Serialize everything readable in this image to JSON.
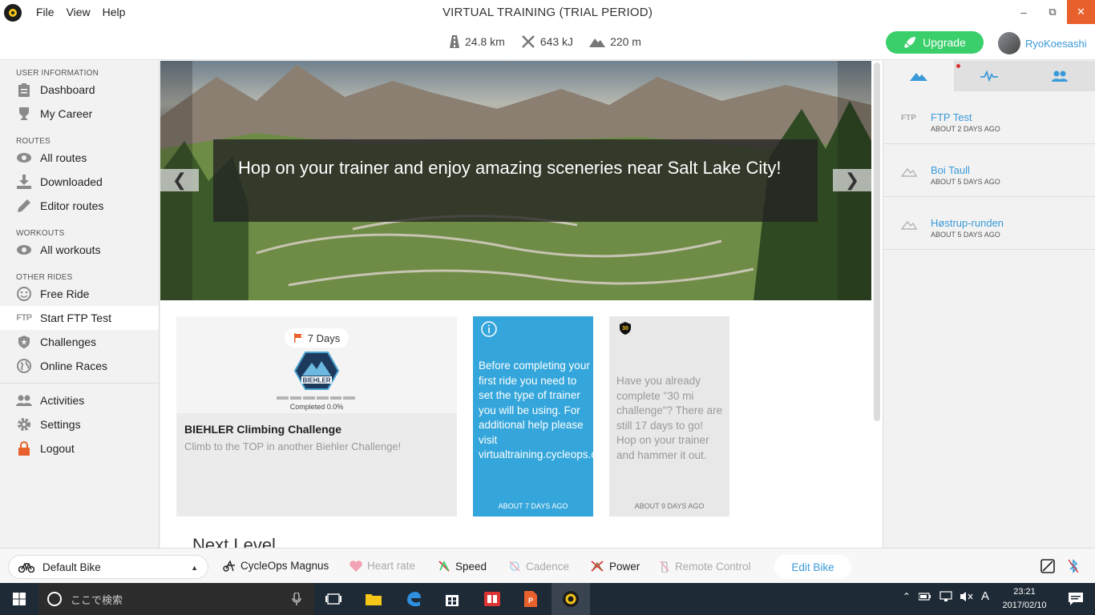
{
  "window": {
    "title": "VIRTUAL TRAINING (TRIAL PERIOD)",
    "menu": [
      "File",
      "View",
      "Help"
    ],
    "minimize": "–",
    "maximize": "⧉",
    "close": "✕"
  },
  "stats": {
    "distance": "24.8 km",
    "energy": "643 kJ",
    "elevation": "220 m"
  },
  "header": {
    "upgrade_label": "Upgrade",
    "username": "RyoKoesashi"
  },
  "sidebar": {
    "sections": [
      {
        "title": "USER INFORMATION",
        "items": [
          {
            "label": "Dashboard",
            "icon": "clipboard-icon"
          },
          {
            "label": "My Career",
            "icon": "trophy-icon"
          }
        ]
      },
      {
        "title": "ROUTES",
        "items": [
          {
            "label": "All routes",
            "icon": "eye-icon"
          },
          {
            "label": "Downloaded",
            "icon": "download-icon"
          },
          {
            "label": "Editor routes",
            "icon": "pencil-icon"
          }
        ]
      },
      {
        "title": "WORKOUTS",
        "items": [
          {
            "label": "All workouts",
            "icon": "eye-icon"
          }
        ]
      },
      {
        "title": "OTHER RIDES",
        "items": [
          {
            "label": "Free Ride",
            "icon": "smiley-icon"
          },
          {
            "label": "Start FTP Test",
            "icon": "ftp-icon"
          },
          {
            "label": "Challenges",
            "icon": "shield-icon"
          },
          {
            "label": "Online Races",
            "icon": "globe-icon"
          }
        ]
      }
    ],
    "bottom_items": [
      {
        "label": "Activities",
        "icon": "people-icon"
      },
      {
        "label": "Settings",
        "icon": "gear-icon"
      },
      {
        "label": "Logout",
        "icon": "lock-icon"
      }
    ],
    "ftp_icon_text": "FTP"
  },
  "hero": {
    "caption": "Hop on your trainer and enjoy amazing sceneries near Salt Lake City!",
    "prev": "❮",
    "next": "❯"
  },
  "challenge_card": {
    "days": "7 Days",
    "progress_text": "Completed 0.0%",
    "progress_fraction": 0.0,
    "title": "BIEHLER Climbing Challenge",
    "subtitle": "Climb to the TOP in another Biehler Challenge!",
    "logo_text": "BIEHLER"
  },
  "info_card": {
    "text": "Before completing your first ride you need to set the type of trainer you will be using. For additional help please visit virtualtraining.cycleops.com.",
    "time": "ABOUT 7 DAYS AGO"
  },
  "chal_card": {
    "icon_text": "30",
    "text": "Have you already complete \"30 mi challenge\"? There are still 17 days to go! Hop on your trainer and hammer it out.",
    "time": "ABOUT 9 DAYS AGO"
  },
  "next_level": "Next Level",
  "activities": [
    {
      "name": "FTP Test",
      "time": "ABOUT 2 DAYS AGO",
      "icon": "FTP"
    },
    {
      "name": "Boi Taull",
      "time": "ABOUT 5 DAYS AGO",
      "icon": "mountain"
    },
    {
      "name": "Høstrup-runden",
      "time": "ABOUT 5 DAYS AGO",
      "icon": "mountain"
    }
  ],
  "bottombar": {
    "bike": "Default Bike",
    "trainer": "CycleOps Magnus",
    "heart_rate": "Heart rate",
    "speed": "Speed",
    "cadence": "Cadence",
    "power": "Power",
    "remote": "Remote Control",
    "edit_bike": "Edit Bike"
  },
  "taskbar": {
    "search_placeholder": "ここで検索",
    "time": "23:21",
    "date": "2017/02/10",
    "ime": "A"
  },
  "colors": {
    "accent_blue": "#34a6db",
    "link_blue": "#3a9ad9",
    "upgrade_green": "#3bcf6b",
    "close_orange": "#e8602c"
  }
}
